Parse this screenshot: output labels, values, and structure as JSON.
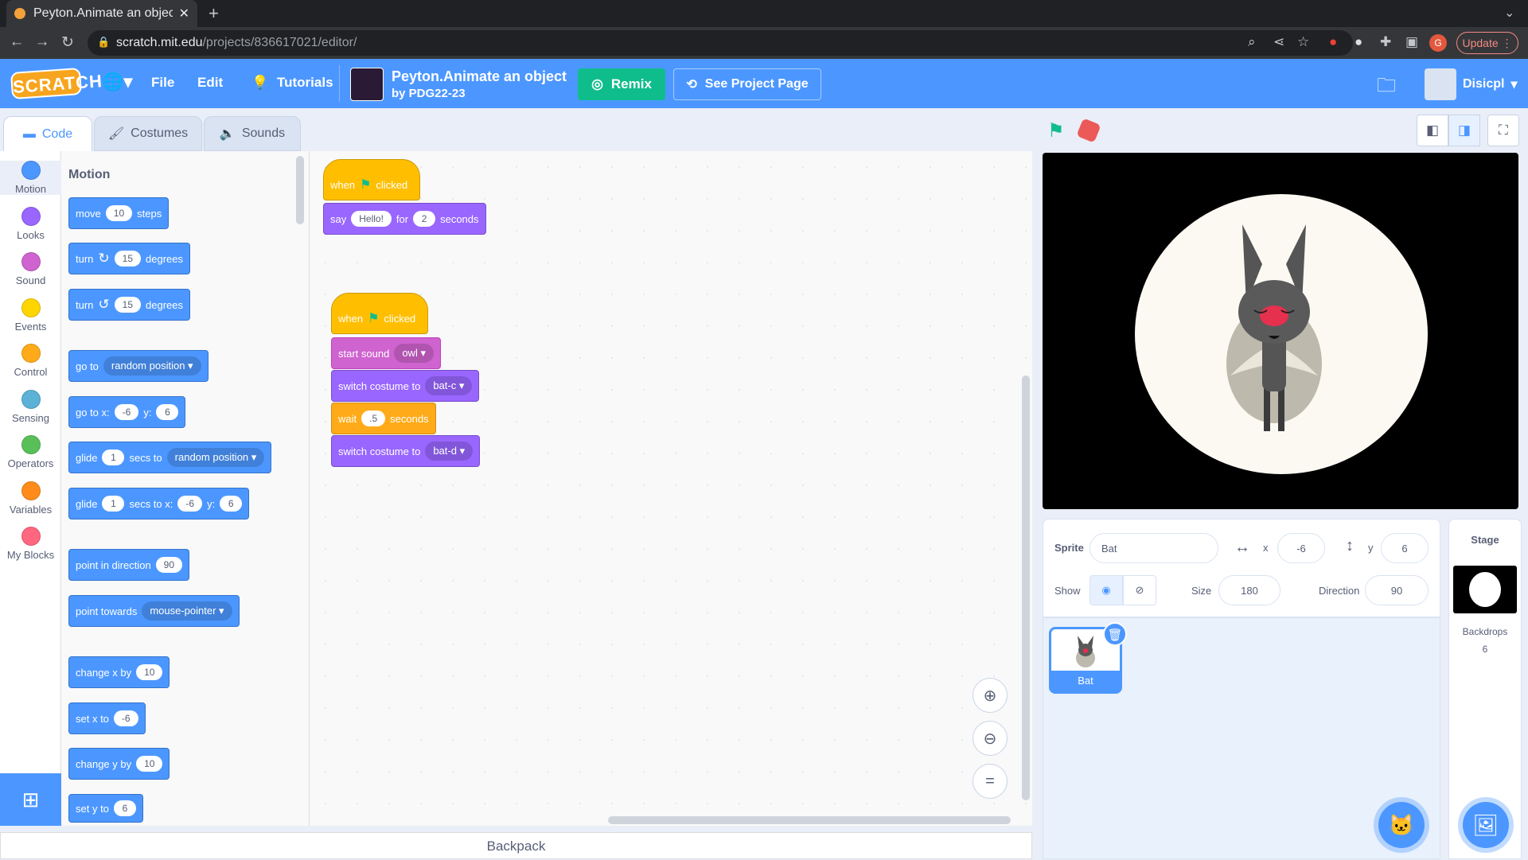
{
  "browser": {
    "tab_title": "Peyton.Animate an object",
    "url_host": "scratch.mit.edu",
    "url_path": "/projects/836617021/editor/",
    "update_label": "Update",
    "profile_letter": "G"
  },
  "menubar": {
    "logo": "SCRATCH",
    "file": "File",
    "edit": "Edit",
    "tutorials": "Tutorials",
    "project_title": "Peyton.Animate an object",
    "project_author": "by PDG22-23",
    "remix": "Remix",
    "see_project": "See Project Page",
    "username": "Disicpl"
  },
  "editor_tabs": {
    "code": "Code",
    "costumes": "Costumes",
    "sounds": "Sounds"
  },
  "categories": [
    {
      "label": "Motion",
      "color": "#4c97ff"
    },
    {
      "label": "Looks",
      "color": "#9966ff"
    },
    {
      "label": "Sound",
      "color": "#cf63cf"
    },
    {
      "label": "Events",
      "color": "#ffd500"
    },
    {
      "label": "Control",
      "color": "#ffab19"
    },
    {
      "label": "Sensing",
      "color": "#5cb1d6"
    },
    {
      "label": "Operators",
      "color": "#59c059"
    },
    {
      "label": "Variables",
      "color": "#ff8c1a"
    },
    {
      "label": "My Blocks",
      "color": "#ff6680"
    }
  ],
  "palette": {
    "title": "Motion",
    "move": {
      "a": "move",
      "v": "10",
      "b": "steps"
    },
    "turn_cw": {
      "a": "turn",
      "v": "15",
      "b": "degrees"
    },
    "turn_ccw": {
      "a": "turn",
      "v": "15",
      "b": "degrees"
    },
    "goto": {
      "a": "go to",
      "dd": "random position"
    },
    "gotoxy": {
      "a": "go to x:",
      "x": "-6",
      "b": "y:",
      "y": "6"
    },
    "glide": {
      "a": "glide",
      "v": "1",
      "b": "secs to",
      "dd": "random position"
    },
    "glidexy": {
      "a": "glide",
      "v": "1",
      "b": "secs to x:",
      "x": "-6",
      "c": "y:",
      "y": "6"
    },
    "pointdir": {
      "a": "point in direction",
      "v": "90"
    },
    "pointtowards": {
      "a": "point towards",
      "dd": "mouse-pointer"
    },
    "changex": {
      "a": "change x by",
      "v": "10"
    },
    "setx": {
      "a": "set x to",
      "v": "-6"
    },
    "changey": {
      "a": "change y by",
      "v": "10"
    },
    "sety": {
      "a": "set y to",
      "v": "6"
    }
  },
  "script1": {
    "hat": {
      "a": "when",
      "b": "clicked"
    },
    "say": {
      "a": "say",
      "msg": "Hello!",
      "b": "for",
      "v": "2",
      "c": "seconds"
    }
  },
  "script2": {
    "hat": {
      "a": "when",
      "b": "clicked"
    },
    "sound": {
      "a": "start sound",
      "dd": "owl"
    },
    "costume1": {
      "a": "switch costume to",
      "dd": "bat-c"
    },
    "wait": {
      "a": "wait",
      "v": ".5",
      "b": "seconds"
    },
    "costume2": {
      "a": "switch costume to",
      "dd": "bat-d"
    }
  },
  "backpack": "Backpack",
  "sprite_info": {
    "sprite_label": "Sprite",
    "sprite_name": "Bat",
    "x_label": "x",
    "x": "-6",
    "y_label": "y",
    "y": "6",
    "show_label": "Show",
    "size_label": "Size",
    "size": "180",
    "direction_label": "Direction",
    "direction": "90"
  },
  "sprites": [
    {
      "name": "Bat",
      "selected": true
    }
  ],
  "stage_panel": {
    "title": "Stage",
    "backdrops_label": "Backdrops",
    "backdrops_count": "6"
  }
}
